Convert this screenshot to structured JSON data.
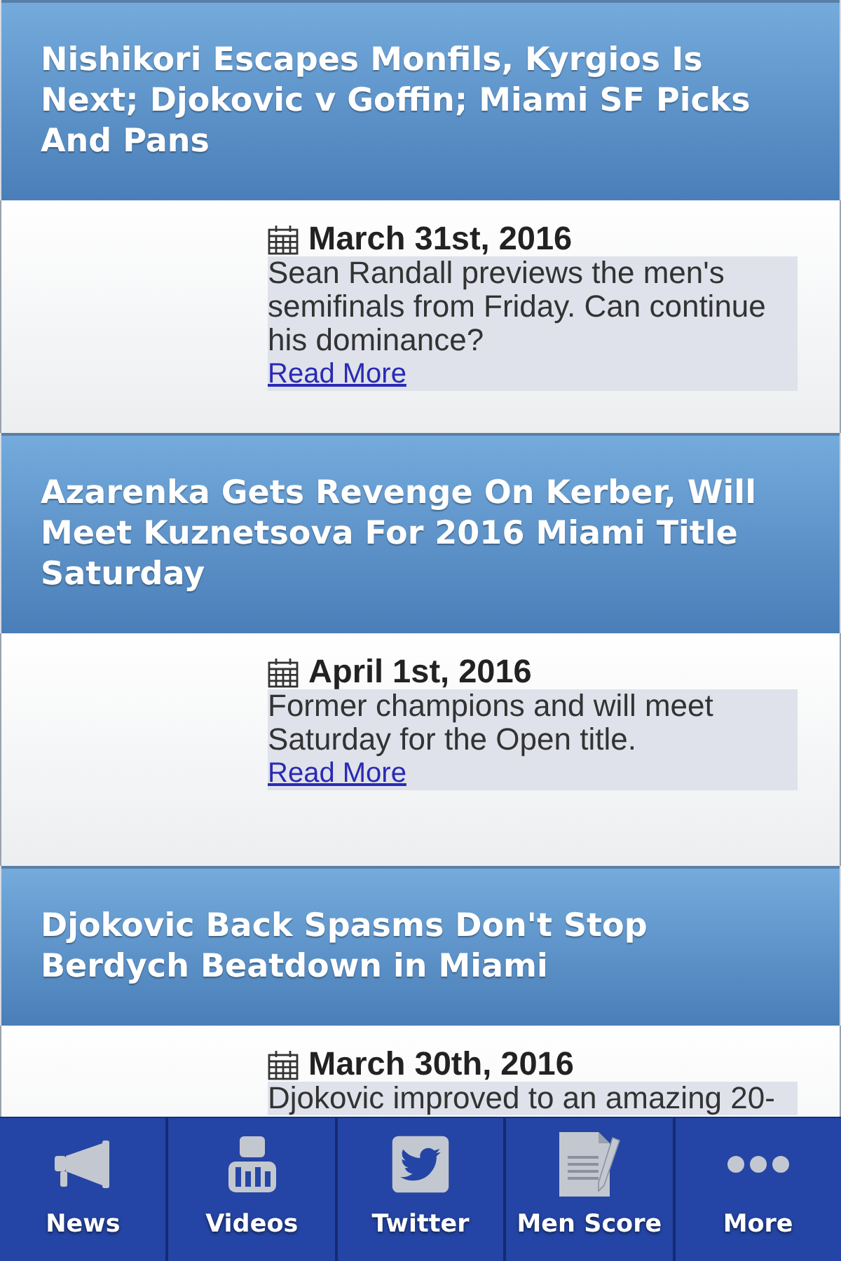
{
  "articles": [
    {
      "title": "Nishikori Escapes Monfils, Kyrgios Is Next; Djokovic v Goffin; Miami SF Picks And Pans",
      "date": "March 31st, 2016",
      "summary": "Sean Randall previews the men's semifinals from Friday. Can continue his dominance?",
      "link": "Read More"
    },
    {
      "title": "Azarenka Gets Revenge On Kerber, Will Meet Kuznetsova For 2016 Miami Title Saturday",
      "date": "April 1st, 2016",
      "summary": "Former champions and will meet Saturday for the Open title.",
      "link": "Read More"
    },
    {
      "title": "Djokovic Back Spasms Don't Stop Berdych Beatdown in Miami",
      "date": "March 30th, 2016",
      "summary": "Djokovic improved to an amazing 20-"
    }
  ],
  "tab_bar": {
    "tabs": [
      {
        "label": "News",
        "kind": "news"
      },
      {
        "label": "Videos",
        "kind": "videos"
      },
      {
        "label": "Twitter",
        "kind": "twitter"
      },
      {
        "label": "Men Score",
        "kind": "scores"
      },
      {
        "label": "More",
        "kind": "more"
      }
    ]
  }
}
